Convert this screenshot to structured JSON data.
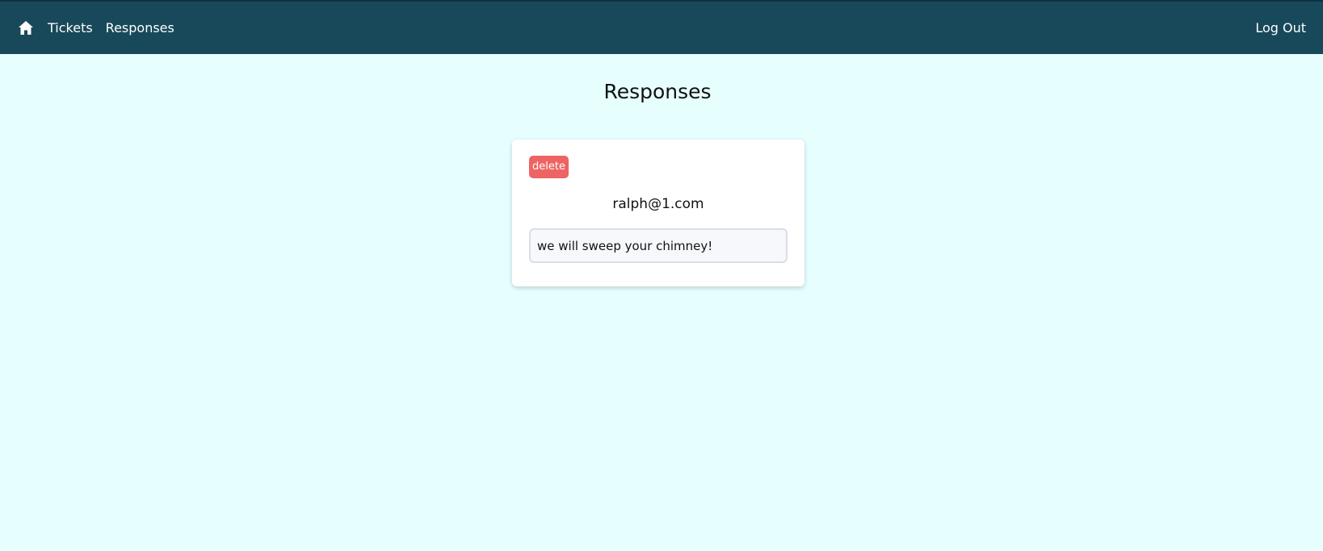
{
  "navbar": {
    "home_icon": "home-icon",
    "links": [
      {
        "label": "Tickets"
      },
      {
        "label": "Responses"
      }
    ],
    "logout_label": "Log Out"
  },
  "main": {
    "title": "Responses",
    "responses": [
      {
        "delete_label": "delete",
        "email": "ralph@1.com",
        "text": "we will sweep your chimney!"
      }
    ]
  },
  "colors": {
    "navbar_bg": "#17495a",
    "page_bg": "#e6fefe",
    "delete_bg": "#ee6363"
  }
}
